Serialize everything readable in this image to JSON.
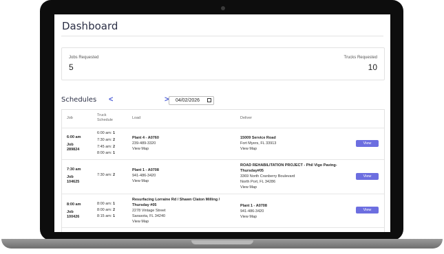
{
  "page": {
    "title": "Dashboard"
  },
  "summary": {
    "jobs_label": "Jobs Requested",
    "jobs_value": "5",
    "trucks_label": "Trucks Requested",
    "trucks_value": "10"
  },
  "schedules": {
    "title": "Schedules",
    "prev": "<",
    "next": ">",
    "date": "04/02/2026",
    "headers": {
      "job": "Job",
      "truck1": "Truck",
      "truck2": "Schedule",
      "load": "Load",
      "deliver": "Deliver"
    },
    "view_label": "View",
    "rows": [
      {
        "time": "6:00 am",
        "job_label": "Job",
        "job_no": "289824",
        "trucks": [
          {
            "time": "6:00 am:",
            "count": "1"
          },
          {
            "time": "7:30 am:",
            "count": "2"
          },
          {
            "time": "7:45 am:",
            "count": "2"
          },
          {
            "time": "8:00 am:",
            "count": "1"
          }
        ],
        "load": {
          "name": "Plant 4 - A0760",
          "phone": "239-489-3320",
          "map": "View Map"
        },
        "deliver": {
          "name": "15009 Service Road",
          "line2": "Fort Myers, FL 33913",
          "map": "View Map"
        }
      },
      {
        "time": "7:30 am",
        "job_label": "Job",
        "job_no": "104625",
        "trucks": [
          {
            "time": "7:30 am:",
            "count": "2"
          }
        ],
        "load": {
          "name": "Plant 1 - A0708",
          "phone": "941-486-3420",
          "map": "View Map"
        },
        "deliver": {
          "name1": "ROAD REHABILITATION PROJECT - Phil Vigo Paving-",
          "name2": "Thursday#05",
          "line2": "3369 North Cranberry Boulevard",
          "line3": "North Port, FL 34286",
          "map": "View Map"
        }
      },
      {
        "time": "8:00 am",
        "job_label": "Job",
        "job_no": "100426",
        "trucks": [
          {
            "time": "8:00 am:",
            "count": "1"
          },
          {
            "time": "8:00 am:",
            "count": "2"
          },
          {
            "time": "8:15 am:",
            "count": "1"
          }
        ],
        "load": {
          "name1": "Resurfacing Lorraine Rd / Shawn Claton Milling /",
          "name2": "Thursday #05",
          "line2": "2278 Vintage Street",
          "line3": "Sarasota, FL 34240",
          "map": "View Map"
        },
        "deliver": {
          "name": "Plant 1 - A0708",
          "phone": "941-486-3420",
          "map": "View Map"
        }
      }
    ]
  }
}
